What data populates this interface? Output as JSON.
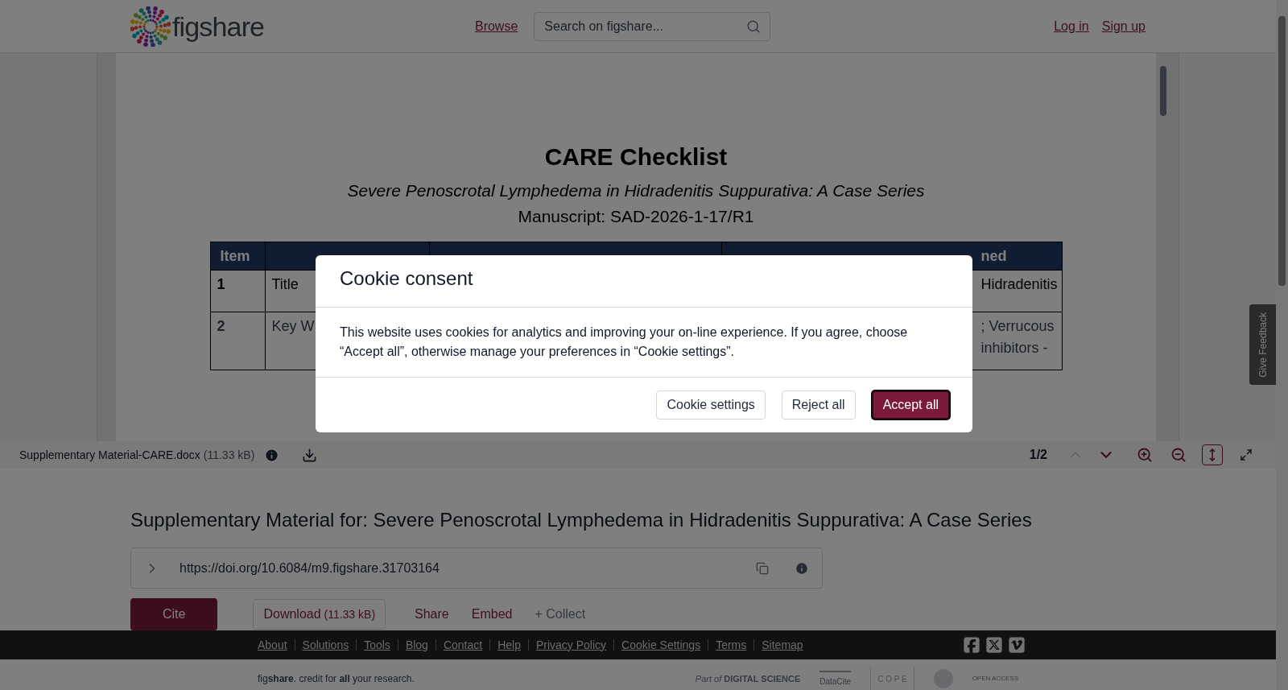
{
  "header": {
    "logo": "figshare",
    "nav": [
      {
        "label": "Browse"
      }
    ],
    "search": {
      "placeholder": "Search on figshare..."
    },
    "auth": [
      "Log in",
      "Sign up"
    ]
  },
  "document": {
    "title": "CARE Checklist",
    "subtitle": "Severe Penoscrotal Lymphedema in Hidradenitis Suppurativa: A Case Series",
    "manuscript": "Manuscript: SAD-2026-1-17/R1",
    "table": {
      "header": {
        "column_1": "Item",
        "column_5": "ned"
      },
      "rows": [
        {
          "column_1": "1",
          "column_2": "Title",
          "column_5": [
            "Hidradenitis"
          ]
        },
        {
          "column_1": "2",
          "column_2": "Key W",
          "column_5": [
            "; Verrucous",
            "inhibitors -"
          ]
        }
      ]
    }
  },
  "viewer_toolbar": {
    "file_name": "Supplementary Material-CARE.docx",
    "file_size": "(11.33 kB)",
    "page": "1/2",
    "nav": [
      {
        "kind": "prev",
        "disabled": true
      },
      {
        "kind": "next",
        "disabled": false
      }
    ],
    "tools": [
      {
        "kind": "zoom_in",
        "selected": false
      },
      {
        "kind": "zoom_out",
        "selected": false
      },
      {
        "kind": "fit_height",
        "selected": true
      },
      {
        "kind": "fullscreen",
        "selected": false
      }
    ]
  },
  "item": {
    "title": "Supplementary Material for: Severe Penoscrotal Lymphedema in Hidradenitis Suppurativa: A Case Series",
    "doi": "https://doi.org/10.6084/m9.figshare.31703164",
    "actions": [
      {
        "kind": "primary",
        "label": "Cite"
      },
      {
        "kind": "outline",
        "label": "Download",
        "extra": "(11.33 kB)"
      },
      {
        "kind": "link",
        "label": "Share"
      },
      {
        "kind": "link",
        "label": "Embed"
      },
      {
        "kind": "muted",
        "label": "+ Collect"
      }
    ]
  },
  "feedback_tab": "Give Feedback",
  "footer": {
    "links": [
      "About",
      "Solutions",
      "Tools",
      "Blog",
      "Contact",
      "Help",
      "Privacy Policy",
      "Cookie Settings",
      "Terms",
      "Sitemap"
    ],
    "tagline": "fig**share**. credit for **all** your research.",
    "partners": [
      {
        "kind": "digital_science",
        "prefix": "Part of",
        "name": "DIGITAL SCIENCE"
      },
      {
        "kind": "datacite",
        "name": "DataCite"
      },
      {
        "kind": "cope",
        "name": "C O P E"
      },
      {
        "kind": "seal"
      },
      {
        "kind": "open_access",
        "name": "OPEN ACCESS"
      }
    ]
  },
  "cookie_dialog": {
    "title": "Cookie consent",
    "body": "This website uses cookies for analytics and improving your on-line experience. If you agree, choose “Accept all”, otherwise manage your preferences in “Cookie settings”.",
    "buttons": [
      {
        "label": "Cookie settings",
        "kind": "secondary"
      },
      {
        "label": "Reject all",
        "kind": "secondary"
      },
      {
        "label": "Accept all",
        "kind": "primary"
      }
    ]
  }
}
